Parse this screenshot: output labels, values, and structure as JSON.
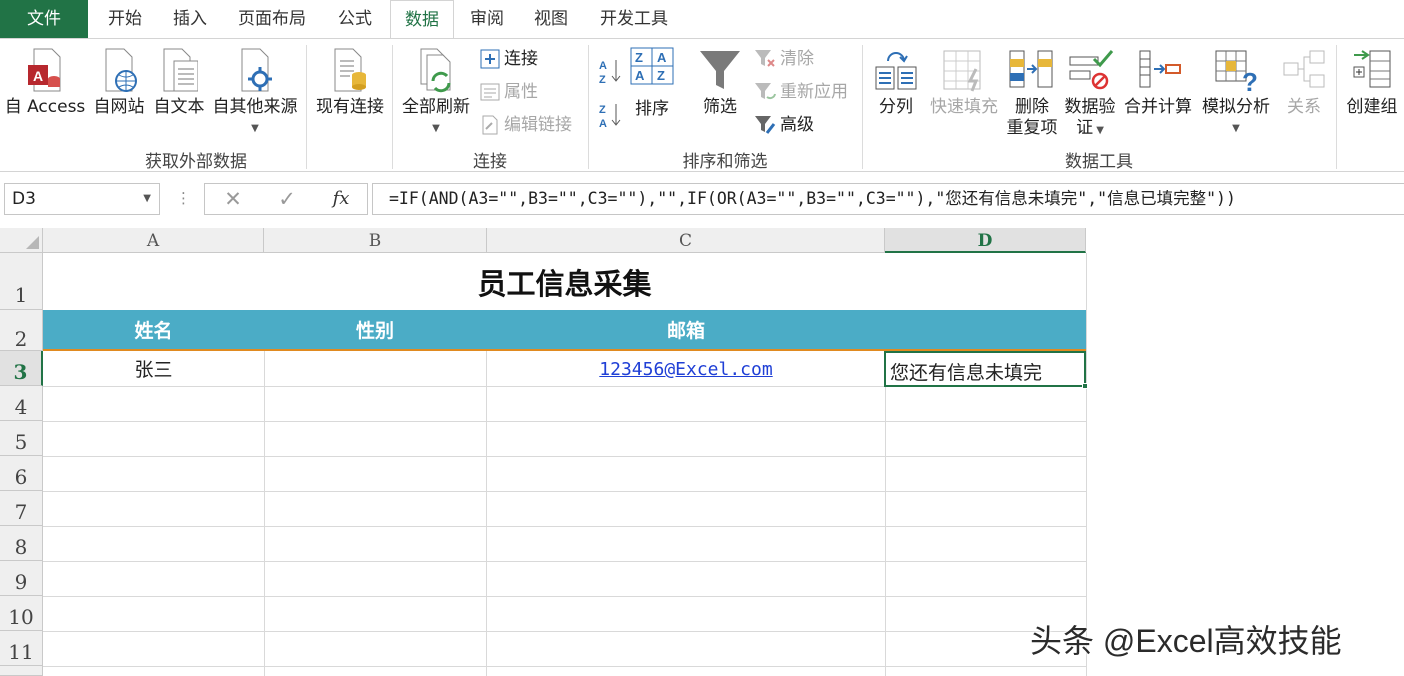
{
  "tabs": [
    "文件",
    "开始",
    "插入",
    "页面布局",
    "公式",
    "数据",
    "审阅",
    "视图",
    "开发工具"
  ],
  "active_tab": "数据",
  "ribbon": {
    "get_external": {
      "from_access": "自 Access",
      "from_web": "自网站",
      "from_text": "自文本",
      "from_other": "自其他来源",
      "existing_connections": "现有连接",
      "group_label": "获取外部数据"
    },
    "connections": {
      "refresh_all": "全部刷新",
      "connections": "连接",
      "properties": "属性",
      "edit_links": "编辑链接",
      "group_label": "连接"
    },
    "sort_filter": {
      "sort": "排序",
      "filter": "筛选",
      "clear": "清除",
      "reapply": "重新应用",
      "advanced": "高级",
      "group_label": "排序和筛选"
    },
    "data_tools": {
      "text_to_columns": "分列",
      "flash_fill": "快速填充",
      "remove_duplicates_1": "删除",
      "remove_duplicates_2": "重复项",
      "data_validation_1": "数据验",
      "data_validation_2": "证",
      "consolidate": "合并计算",
      "what_if": "模拟分析",
      "relationships": "关系",
      "group_label": "数据工具"
    },
    "outline": {
      "group": "创建组"
    }
  },
  "formula_bar": {
    "name_box": "D3",
    "cancel": "✕",
    "enter": "✓",
    "fx": "fx",
    "formula": "=IF(AND(A3=\"\",B3=\"\",C3=\"\"),\"\",IF(OR(A3=\"\",B3=\"\",C3=\"\"),\"您还有信息未填完\",\"信息已填完整\"))"
  },
  "grid": {
    "columns": [
      "A",
      "B",
      "C",
      "D"
    ],
    "selected_column": "D",
    "rows": [
      "1",
      "2",
      "3",
      "4",
      "5",
      "6",
      "7",
      "8",
      "9",
      "10",
      "11"
    ],
    "selected_row": "3",
    "title": "员工信息采集",
    "headers": [
      "姓名",
      "性别",
      "邮箱"
    ],
    "row3": {
      "A": "张三",
      "B": "",
      "C": "123456@Excel.com",
      "D": "您还有信息未填完"
    }
  },
  "watermark": "头条 @Excel高效技能",
  "colors": {
    "accent": "#217346",
    "header_band": "#4bacc6",
    "header_border": "#e08a20",
    "link": "#1f3fd6"
  }
}
